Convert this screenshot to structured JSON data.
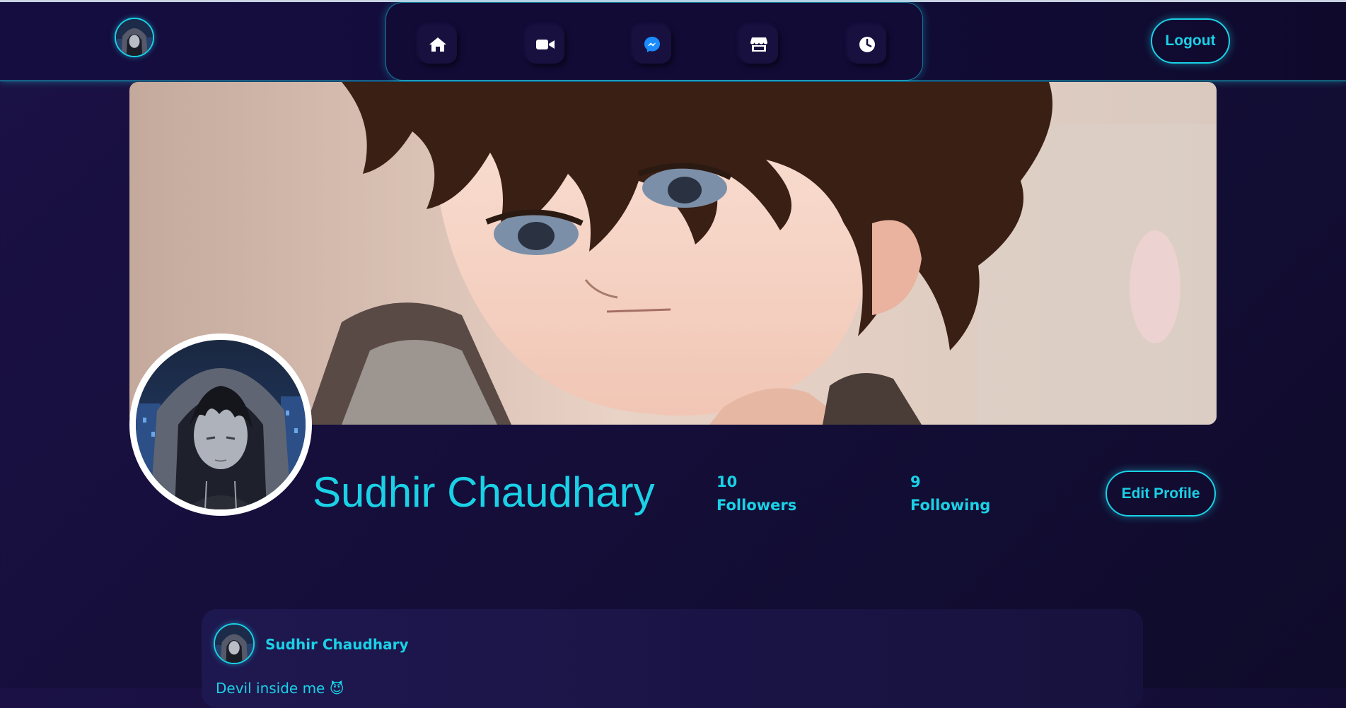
{
  "header": {
    "avatar_alt": "User avatar",
    "logout_label": "Logout",
    "nav_items": [
      {
        "icon": "home-icon",
        "label": "Home"
      },
      {
        "icon": "video-icon",
        "label": "Videos"
      },
      {
        "icon": "messenger-icon",
        "label": "Messenger"
      },
      {
        "icon": "store-icon",
        "label": "Marketplace"
      },
      {
        "icon": "clock-icon",
        "label": "Memories"
      }
    ]
  },
  "profile": {
    "name": "Sudhir Chaudhary",
    "followers_count": "10",
    "followers_label": "Followers",
    "following_count": "9",
    "following_label": "Following",
    "edit_label": "Edit Profile"
  },
  "post": {
    "author": "Sudhir Chaudhary",
    "text": "Devil inside me 😈"
  },
  "colors": {
    "accent": "#1ad1e6",
    "background": "#140e38",
    "card": "#1c1649"
  }
}
